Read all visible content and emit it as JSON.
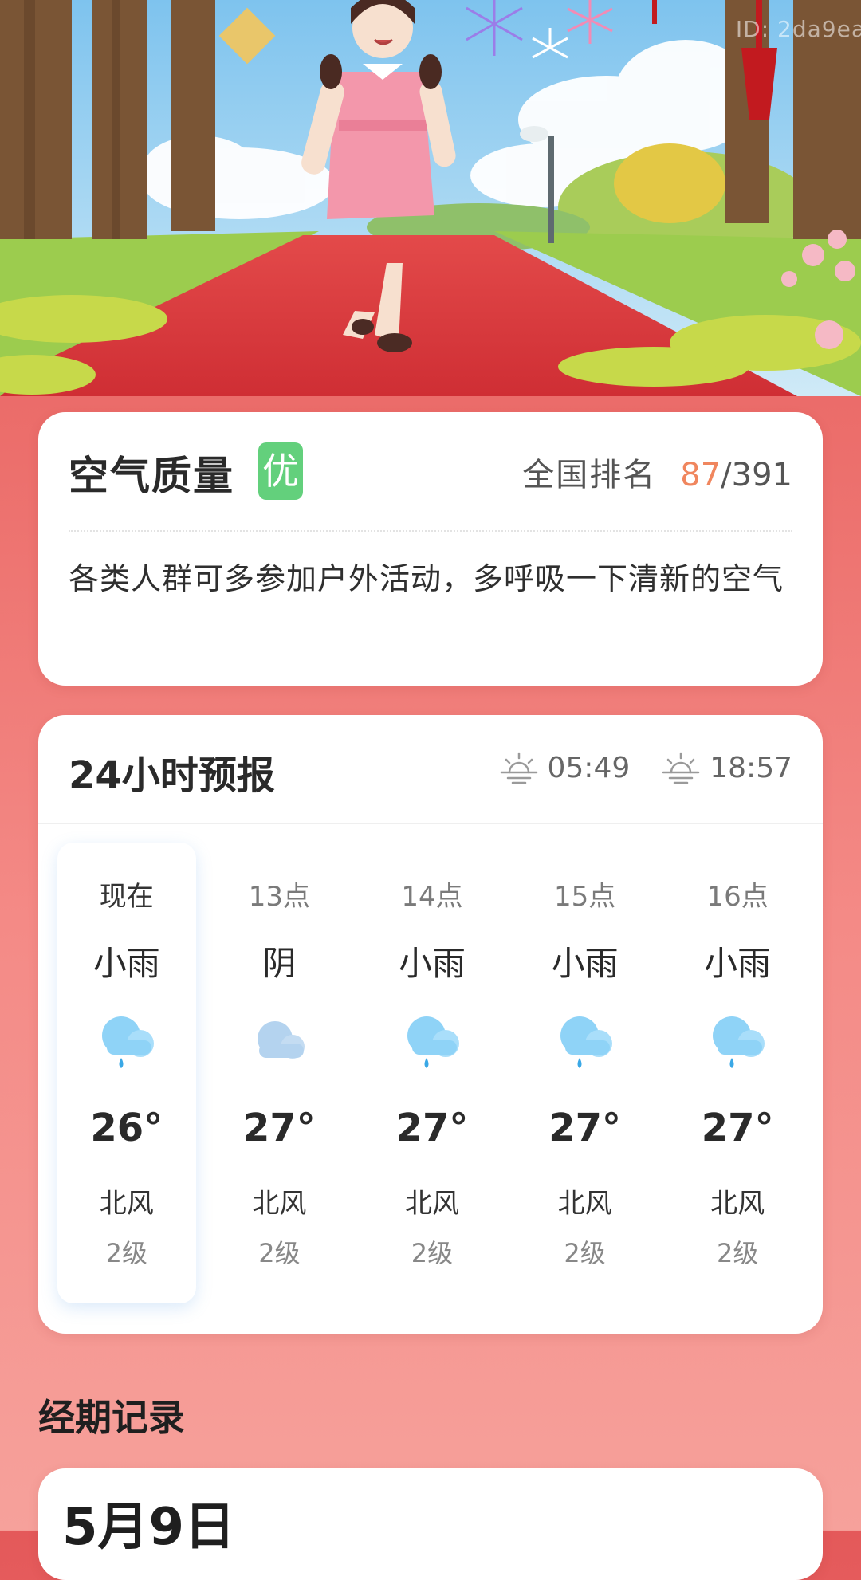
{
  "watermark": "ID: 2da9ea",
  "air_quality": {
    "title": "空气质量",
    "level": "优",
    "level_color": "#63d07c",
    "rank_label": "全国排名",
    "rank": "87",
    "rank_total": "/391",
    "rank_color": "#f0865e",
    "description": "各类人群可多参加户外活动，多呼吸一下清新的空气"
  },
  "forecast": {
    "title": "24小时预报",
    "sunrise_icon": "sunrise-icon",
    "sunrise": "05:49",
    "sunset_icon": "sunset-icon",
    "sunset": "18:57",
    "hours": [
      {
        "time": "现在",
        "condition": "小雨",
        "icon": "light-rain-icon",
        "temp": "26°",
        "wind": "北风",
        "level": "2级"
      },
      {
        "time": "13点",
        "condition": "阴",
        "icon": "overcast-icon",
        "temp": "27°",
        "wind": "北风",
        "level": "2级"
      },
      {
        "time": "14点",
        "condition": "小雨",
        "icon": "light-rain-icon",
        "temp": "27°",
        "wind": "北风",
        "level": "2级"
      },
      {
        "time": "15点",
        "condition": "小雨",
        "icon": "light-rain-icon",
        "temp": "27°",
        "wind": "北风",
        "level": "2级"
      },
      {
        "time": "16点",
        "condition": "小雨",
        "icon": "light-rain-icon",
        "temp": "27°",
        "wind": "北风",
        "level": "2级"
      }
    ]
  },
  "period": {
    "title": "经期记录",
    "date": "5月9日"
  }
}
